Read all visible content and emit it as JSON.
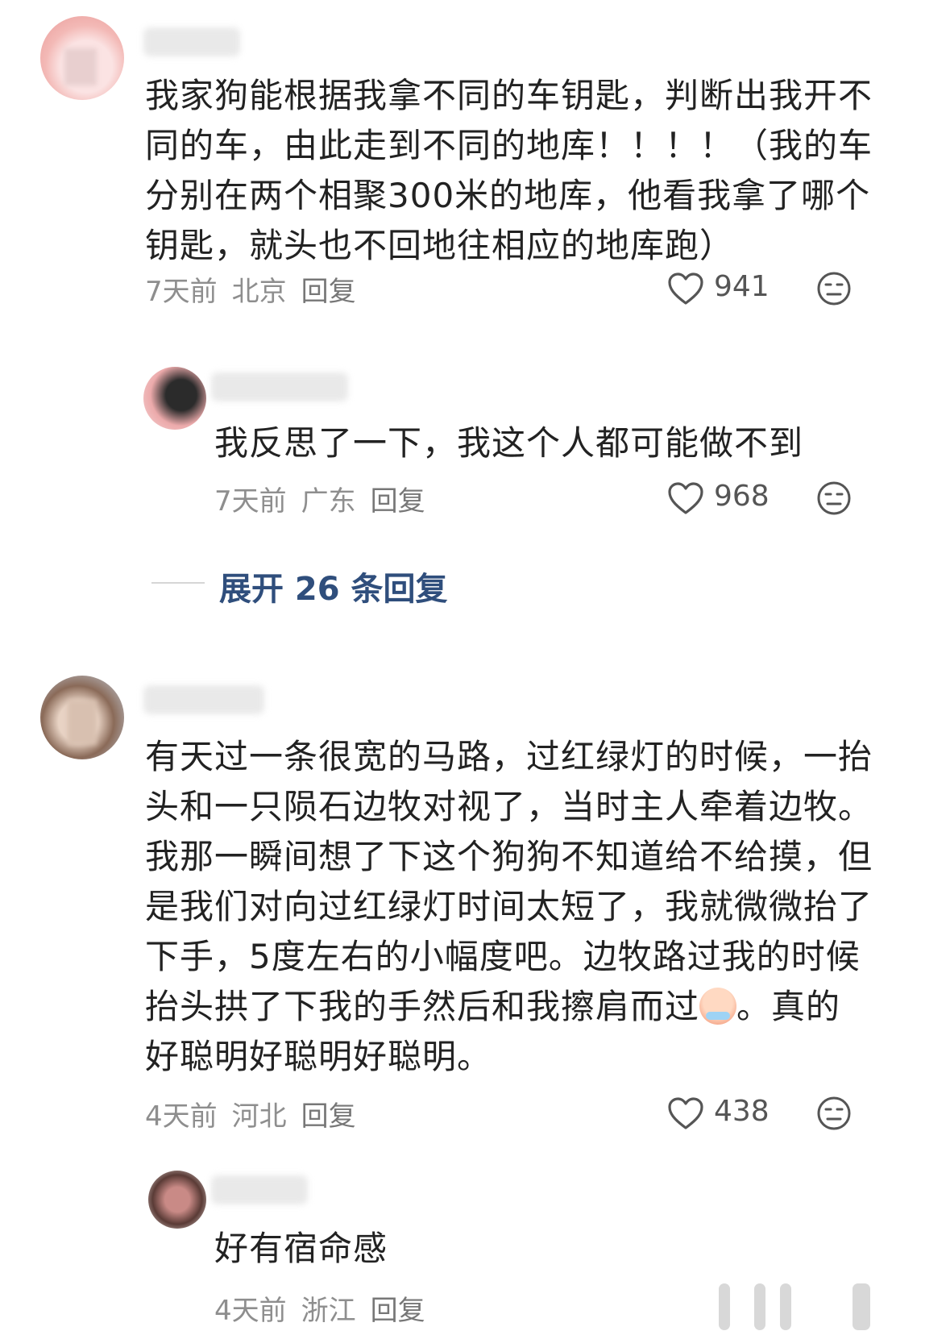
{
  "comments": [
    {
      "text": "我家狗能根据我拿不同的车钥匙，判断出我开不同的车，由此走到不同的地库！！！！（我的车分别在两个相聚300米的地库，他看我拿了哪个钥匙，就头也不回地往相应的地库跑）",
      "time": "7天前",
      "location": "北京",
      "reply_label": "回复",
      "likes": "941",
      "replies": [
        {
          "text": "我反思了一下，我这个人都可能做不到",
          "time": "7天前",
          "location": "广东",
          "reply_label": "回复",
          "likes": "968"
        }
      ],
      "expand_label": "展开 26 条回复"
    },
    {
      "text_part1": "有天过一条很宽的马路，过红绿灯的时候，一抬头和一只陨石边牧对视了，当时主人牵着边牧。我那一瞬间想了下这个狗狗不知道给不给摸，但是我们对向过红绿灯时间太短了，我就微微抬了下手，5度左右的小幅度吧。边牧路过我的时候抬头拱了下我的手然后和我擦肩而过",
      "text_part2": "。真的好聪明好聪明好聪明。",
      "time": "4天前",
      "location": "河北",
      "reply_label": "回复",
      "likes": "438",
      "replies": [
        {
          "text": "好有宿命感",
          "time": "4天前",
          "location": "浙江",
          "reply_label": "回复"
        }
      ]
    }
  ],
  "icons": {
    "like": "heart-outline-icon",
    "dislike": "neutral-face-icon",
    "emoji": "crying-laughing-emoji"
  }
}
